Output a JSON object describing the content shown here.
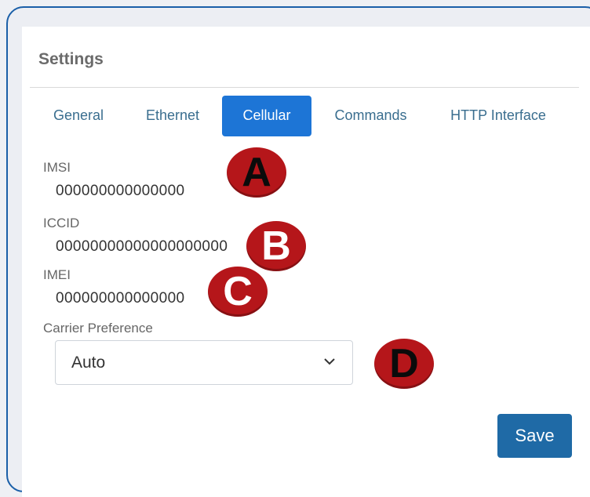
{
  "panel": {
    "title": "Settings"
  },
  "tabs": [
    {
      "label": "General",
      "active": false
    },
    {
      "label": "Ethernet",
      "active": false
    },
    {
      "label": "Cellular",
      "active": true
    },
    {
      "label": "Commands",
      "active": false
    },
    {
      "label": "HTTP Interface",
      "active": false
    }
  ],
  "fields": {
    "imsi": {
      "label": "IMSI",
      "value": "000000000000000"
    },
    "iccid": {
      "label": "ICCID",
      "value": "00000000000000000000"
    },
    "imei": {
      "label": "IMEI",
      "value": "000000000000000"
    }
  },
  "carrier": {
    "label": "Carrier Preference",
    "selected": "Auto",
    "icon": "chevron-down-icon"
  },
  "save_label": "Save",
  "markers": {
    "a": "A",
    "b": "B",
    "c": "C",
    "d": "D"
  },
  "colors": {
    "accent": "#1d75d6",
    "save_button": "#1f6aa6",
    "marker": "#b5161a",
    "frame": "#1a5fa8"
  }
}
